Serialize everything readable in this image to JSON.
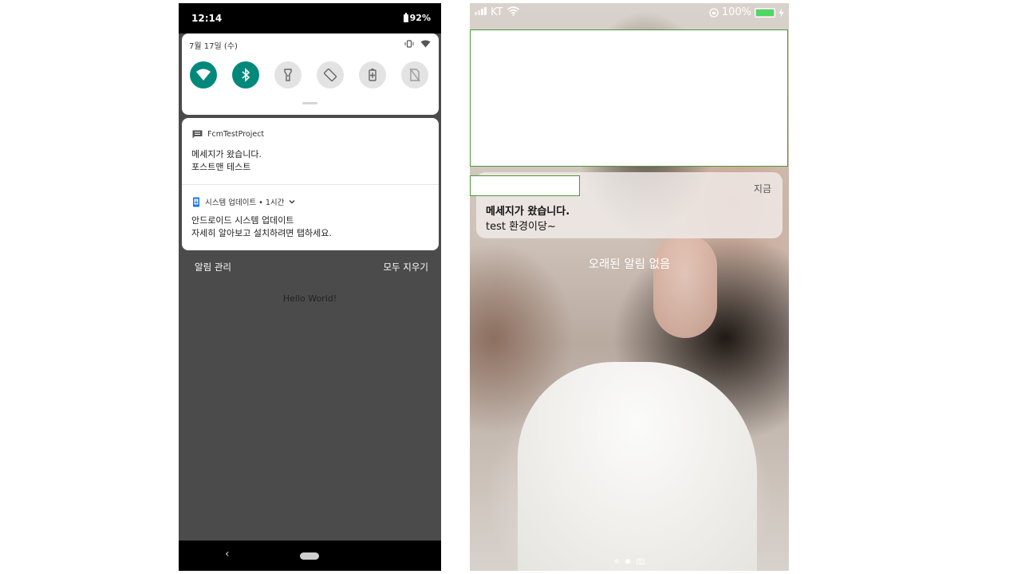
{
  "android": {
    "status_bar": {
      "time": "12:14",
      "battery": "92%"
    },
    "quick_settings": {
      "date": "7월 17일 (수)",
      "tiles": [
        {
          "name": "wifi",
          "state": "on"
        },
        {
          "name": "bluetooth",
          "state": "on"
        },
        {
          "name": "flashlight",
          "state": "off"
        },
        {
          "name": "auto-rotate",
          "state": "off"
        },
        {
          "name": "battery-saver",
          "state": "off"
        },
        {
          "name": "data",
          "state": "off"
        }
      ]
    },
    "notifications": [
      {
        "app": "FcmTestProject",
        "title": "메세지가 왔습니다.",
        "body": "포스트맨 테스트"
      },
      {
        "app": "시스템 업데이트 • 1시간",
        "title": "안드로이드 시스템 업데이트",
        "body": "자세히 알아보고 설치하려면 탭하세요."
      }
    ],
    "manage_label": "알림 관리",
    "clear_all_label": "모두 지우기",
    "app_text": "Hello World!",
    "colors": {
      "accent": "#00897b",
      "shade": "#4b4b4b"
    }
  },
  "ios": {
    "status_bar": {
      "carrier": "KT",
      "battery": "100%"
    },
    "notification": {
      "time": "지금",
      "title": "메세지가 왔습니다.",
      "body": "test 환경이당~"
    },
    "no_older": "오래된 알림 없음",
    "page_indicator": {
      "pages": 2,
      "current": 2,
      "has_camera": true
    },
    "colors": {
      "battery": "#4cd964",
      "highlight_border": "#4a9a33"
    }
  }
}
